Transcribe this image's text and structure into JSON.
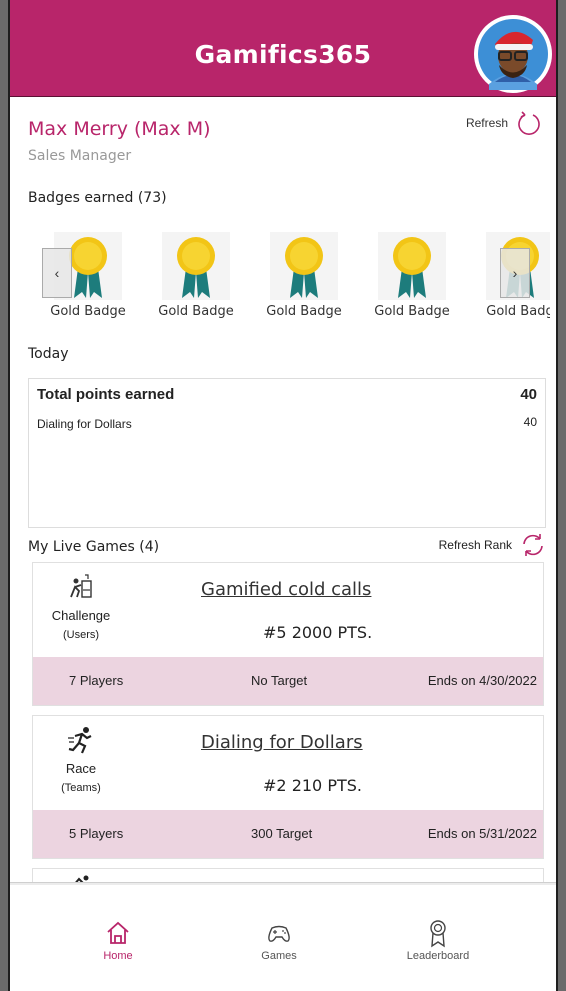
{
  "app": {
    "title": "Gamifics365",
    "brand_color": "#b8256a",
    "accent_footer_color": "#ecd4e0"
  },
  "profile": {
    "name": "Max Merry (Max M)",
    "role": "Sales Manager",
    "refresh_label": "Refresh"
  },
  "badges": {
    "heading": "Badges earned (73)",
    "items": [
      {
        "label": "Gold Badge",
        "icon": "gold-badge-icon"
      },
      {
        "label": "Gold Badge",
        "icon": "gold-badge-icon"
      },
      {
        "label": "Gold Badge",
        "icon": "gold-badge-icon"
      },
      {
        "label": "Gold Badge",
        "icon": "gold-badge-icon"
      },
      {
        "label": "Gold Badg",
        "icon": "gold-badge-icon"
      }
    ],
    "prev_label": "‹",
    "next_label": "›"
  },
  "today": {
    "heading": "Today",
    "total_label": "Total points earned",
    "total_value": "40",
    "rows": [
      {
        "label": "Dialing for Dollars",
        "value": "40"
      }
    ]
  },
  "games": {
    "heading": "My Live Games (4)",
    "refresh_rank_label": "Refresh Rank",
    "items": [
      {
        "type": "Challenge",
        "scope": "(Users)",
        "icon": "challenge-icon",
        "title": "Gamified cold calls",
        "rank": "#5",
        "points": "2000 PTS.",
        "players": "7 Players",
        "target": "No Target",
        "ends": "Ends on 4/30/2022"
      },
      {
        "type": "Race",
        "scope": "(Teams)",
        "icon": "race-icon",
        "title": "Dialing for Dollars",
        "rank": "#2",
        "points": "210 PTS.",
        "players": "5 Players",
        "target": "300 Target",
        "ends": "Ends on 5/31/2022"
      }
    ]
  },
  "tabs": [
    {
      "label": "Home",
      "icon": "home-icon",
      "active": true
    },
    {
      "label": "Games",
      "icon": "gamepad-icon",
      "active": false
    },
    {
      "label": "Leaderboard",
      "icon": "award-icon",
      "active": false
    }
  ]
}
